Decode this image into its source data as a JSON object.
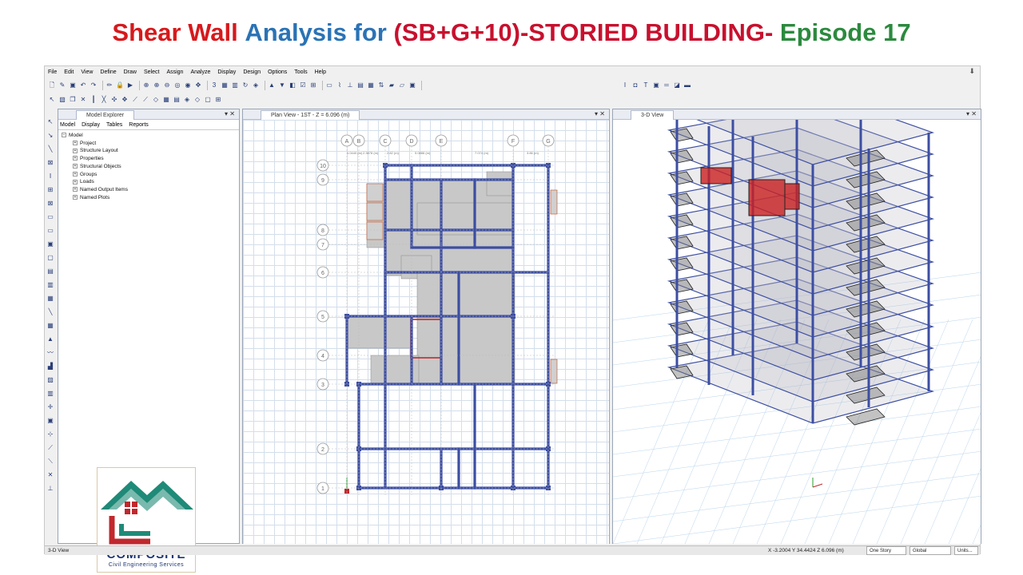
{
  "banner": {
    "parts": [
      {
        "text": "Shear Wall ",
        "color": "#d7191c"
      },
      {
        "text": "Analysis for ",
        "color": "#2a73b5"
      },
      {
        "text": "(SB+G+10)-STORIED BUILDING- ",
        "color": "#c8102e"
      },
      {
        "text": "Episode 17",
        "color": "#2b8a3e"
      }
    ]
  },
  "menu": [
    "File",
    "Edit",
    "View",
    "Define",
    "Draw",
    "Select",
    "Assign",
    "Analyze",
    "Display",
    "Design",
    "Options",
    "Tools",
    "Help"
  ],
  "explorer": {
    "title": "Model Explorer",
    "tabs": [
      "Model",
      "Display",
      "Tables",
      "Reports"
    ],
    "root": "Model",
    "items": [
      "Project",
      "Structure Layout",
      "Properties",
      "Structural Objects",
      "Groups",
      "Loads",
      "Named Output Items",
      "Named Plots"
    ]
  },
  "plan": {
    "title": "Plan View - 1ST - Z = 6.096 (m)",
    "col_grids": [
      "A",
      "B",
      "C",
      "D",
      "E",
      "F",
      "G"
    ],
    "row_grids": [
      "10",
      "9",
      "8",
      "7",
      "6",
      "5",
      "4",
      "3",
      "2",
      "1"
    ],
    "dims_top": [
      "1.0440 (m)",
      "2.3878 (m)",
      "2.82 (m)",
      "5.0886 (m)",
      "7.074 (m)",
      "3.86 (m)"
    ]
  },
  "view3d": {
    "title": "3-D View"
  },
  "logo": {
    "name": "COMPOSITE",
    "tagline": "Civil Engineering Services"
  },
  "status": {
    "view": "3-D View",
    "coords": "X -3.2004  Y 34.4424  Z 6.096 (m)",
    "story": "One Story",
    "system": "Global",
    "units": "Units..."
  },
  "colors": {
    "beam": "#3c4ea2",
    "wall": "#cc2020",
    "slab": "#c8c8c8",
    "logo_green": "#1f8a78",
    "logo_red": "#c0282d"
  }
}
